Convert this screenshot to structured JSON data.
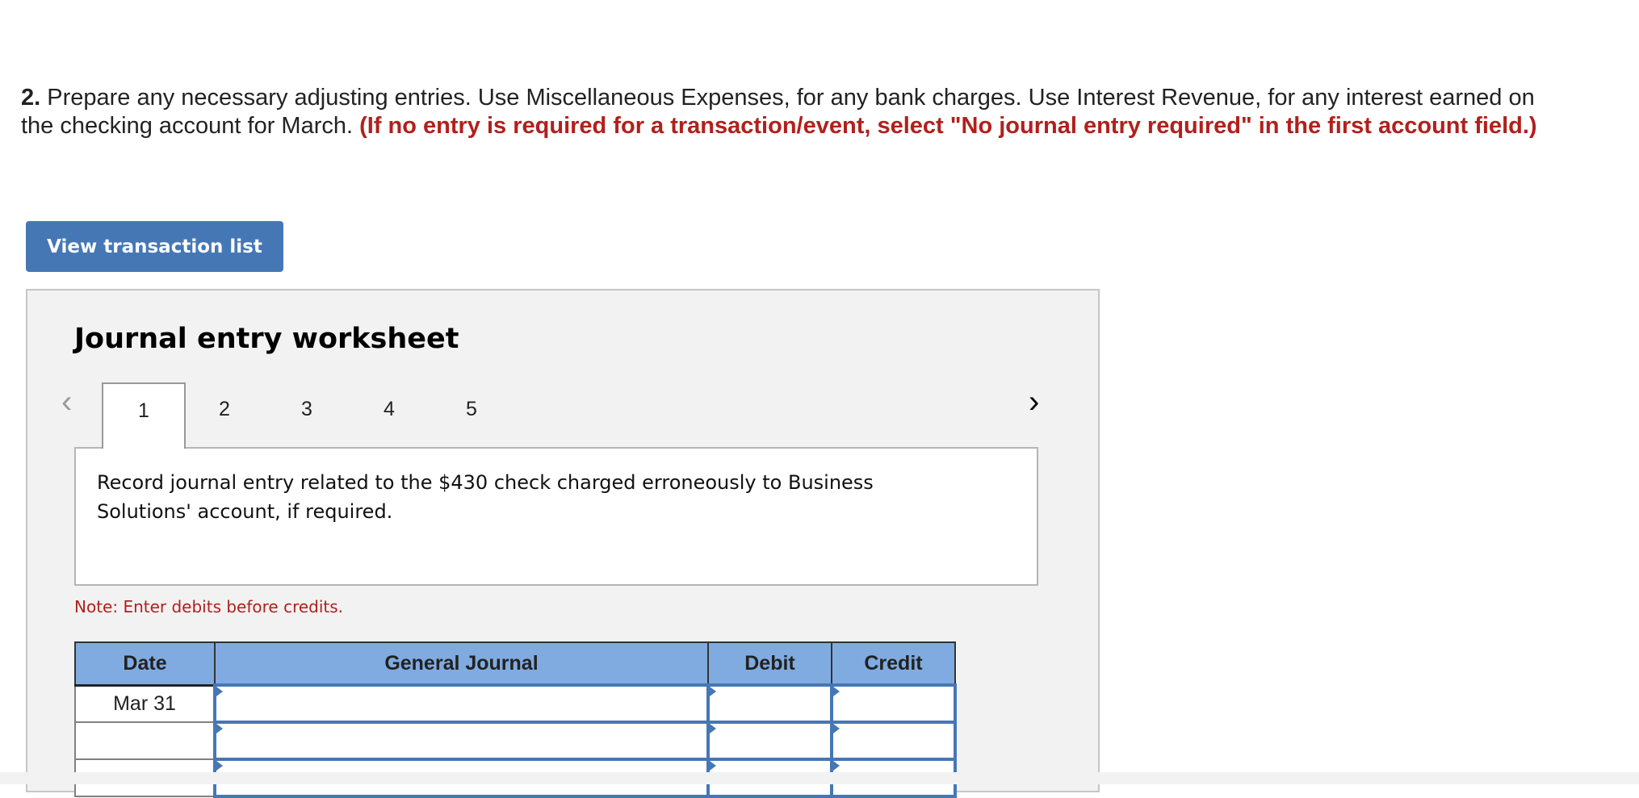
{
  "question": {
    "number": "2.",
    "text": " Prepare any necessary adjusting entries. Use Miscellaneous Expenses, for any bank charges. Use Interest Revenue, for any interest earned on the checking account for March. ",
    "instruction": "(If no entry is required for a transaction/event, select \"No journal entry required\" in the first account field.)"
  },
  "view_button": "View transaction list",
  "worksheet": {
    "title": "Journal entry worksheet",
    "tabs": [
      "1",
      "2",
      "3",
      "4",
      "5"
    ],
    "active_tab": "1",
    "description": "Record journal entry related to the $430 check charged erroneously to Business Solutions' account, if required.",
    "note": "Note: Enter debits before credits.",
    "table": {
      "headers": [
        "Date",
        "General Journal",
        "Debit",
        "Credit"
      ],
      "rows": [
        {
          "date": "Mar 31",
          "account": "",
          "debit": "",
          "credit": ""
        },
        {
          "date": "",
          "account": "",
          "debit": "",
          "credit": ""
        },
        {
          "date": "",
          "account": "",
          "debit": "",
          "credit": ""
        }
      ]
    }
  },
  "colors": {
    "accent": "#4677b5",
    "header": "#80abe0",
    "instruction": "#b1201c"
  }
}
